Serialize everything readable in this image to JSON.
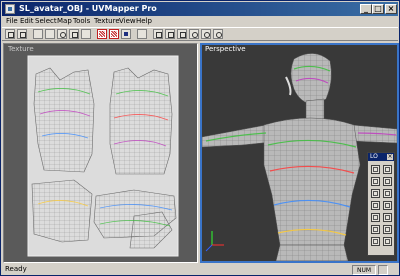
{
  "window": {
    "title": "SL_avatar_OBJ - UVMapper Pro"
  },
  "title_controls": {
    "minimize": "_",
    "maximize": "□",
    "close": "×"
  },
  "menu": [
    "File",
    "Edit",
    "Select",
    "Map",
    "Tools",
    "Texture",
    "View",
    "Help"
  ],
  "panels": {
    "texture_label": "Texture",
    "perspective_label": "Perspective"
  },
  "mini_palette": {
    "title": "LO",
    "close": "×"
  },
  "status": {
    "text": "Ready",
    "indicator": "NUM"
  }
}
